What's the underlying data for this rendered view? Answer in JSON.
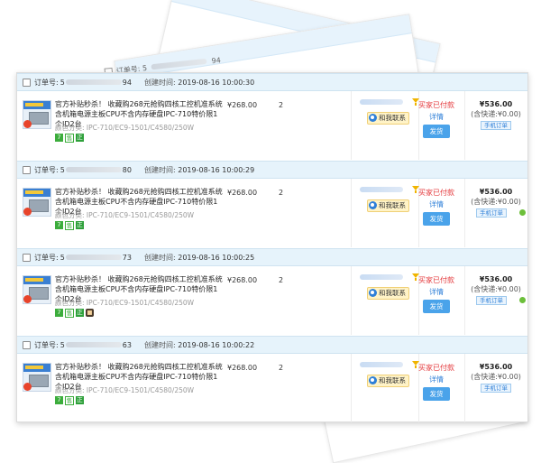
{
  "labels": {
    "order_no": "订单号:",
    "created": "创建时间:",
    "variant_prefix": "颜色分类:",
    "contact": "和我联系",
    "status": "买家已付款",
    "detail": "详情",
    "ship_button": "发货",
    "action": "手机订单"
  },
  "product": {
    "title": "官方补贴秒杀！ 收藏购268元抢购四核工控机准系统含机箱电源主板CPU不含内存硬盘IPC-710特价限1个ID2台",
    "variant": "IPC-710/EC9-1501/C4580/250W"
  },
  "ghost": {
    "order_prefix": "订单号: 5",
    "order_suffix": "94"
  },
  "orders": [
    {
      "order_prefix": "5",
      "order_suffix": "94",
      "created_time": "2019-08-16 10:00:30",
      "price": "¥268.00",
      "qty": "2",
      "total": "¥536.00",
      "shipping": "(含快递:¥0.00)",
      "badges": [
        "7",
        "售",
        "正"
      ],
      "extra_icon": false
    },
    {
      "order_prefix": "5",
      "order_suffix": "80",
      "created_time": "2019-08-16 10:00:29",
      "price": "¥268.00",
      "qty": "2",
      "total": "¥536.00",
      "shipping": "(含快递:¥0.00)",
      "badges": [
        "7",
        "售",
        "正"
      ],
      "extra_icon": true
    },
    {
      "order_prefix": "5",
      "order_suffix": "73",
      "created_time": "2019-08-16 10:00:25",
      "price": "¥268.00",
      "qty": "2",
      "total": "¥536.00",
      "shipping": "(含快递:¥0.00)",
      "badges": [
        "7",
        "售",
        "正"
      ],
      "extra_icon": true
    },
    {
      "order_prefix": "5",
      "order_suffix": "63",
      "created_time": "2019-08-16 10:00:22",
      "price": "¥268.00",
      "qty": "2",
      "total": "¥536.00",
      "shipping": "(含快递:¥0.00)",
      "badges": [
        "7",
        "售",
        "正"
      ],
      "extra_icon": false
    }
  ]
}
